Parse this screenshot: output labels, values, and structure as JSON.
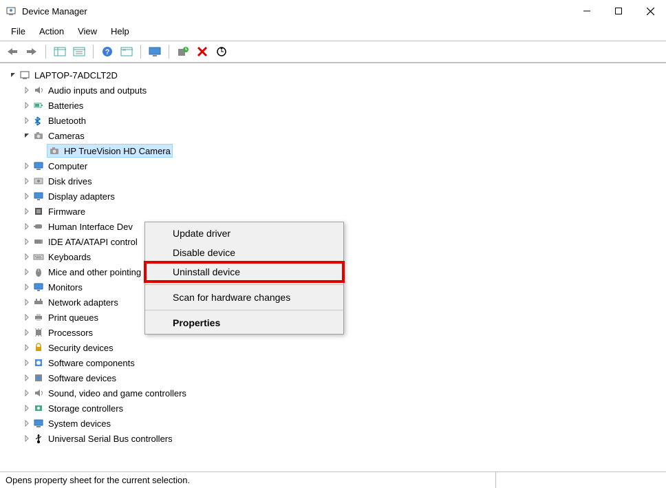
{
  "window": {
    "title": "Device Manager"
  },
  "menubar": [
    "File",
    "Action",
    "View",
    "Help"
  ],
  "toolbar_icons": [
    "back-icon",
    "forward-icon",
    "sep",
    "show-hide-console-tree-icon",
    "help-icon",
    "sep",
    "action-help-icon",
    "properties-page-icon",
    "sep",
    "monitor-icon",
    "sep",
    "update-driver-icon",
    "uninstall-icon",
    "scan-hardware-icon"
  ],
  "tree": {
    "root": {
      "label": "LAPTOP-7ADCLT2D",
      "expanded": true
    },
    "categories": [
      {
        "label": "Audio inputs and outputs",
        "icon": "speaker-icon",
        "expanded": false
      },
      {
        "label": "Batteries",
        "icon": "battery-icon",
        "expanded": false
      },
      {
        "label": "Bluetooth",
        "icon": "bluetooth-icon",
        "expanded": false
      },
      {
        "label": "Cameras",
        "icon": "camera-icon",
        "expanded": true,
        "children": [
          {
            "label": "HP TrueVision HD Camera",
            "icon": "camera-icon",
            "selected": true
          }
        ]
      },
      {
        "label": "Computer",
        "icon": "computer-icon",
        "expanded": false
      },
      {
        "label": "Disk drives",
        "icon": "disk-icon",
        "expanded": false
      },
      {
        "label": "Display adapters",
        "icon": "display-icon",
        "expanded": false
      },
      {
        "label": "Firmware",
        "icon": "firmware-icon",
        "expanded": false
      },
      {
        "label": "Human Interface Devices",
        "icon": "hid-icon",
        "expanded": false,
        "truncated": "Human Interface Dev"
      },
      {
        "label": "IDE ATA/ATAPI controllers",
        "icon": "ide-icon",
        "expanded": false,
        "truncated": "IDE ATA/ATAPI control"
      },
      {
        "label": "Keyboards",
        "icon": "keyboard-icon",
        "expanded": false
      },
      {
        "label": "Mice and other pointing devices",
        "icon": "mouse-icon",
        "expanded": false
      },
      {
        "label": "Monitors",
        "icon": "monitor-icon",
        "expanded": false
      },
      {
        "label": "Network adapters",
        "icon": "network-icon",
        "expanded": false
      },
      {
        "label": "Print queues",
        "icon": "printer-icon",
        "expanded": false
      },
      {
        "label": "Processors",
        "icon": "processor-icon",
        "expanded": false
      },
      {
        "label": "Security devices",
        "icon": "security-icon",
        "expanded": false
      },
      {
        "label": "Software components",
        "icon": "software-comp-icon",
        "expanded": false
      },
      {
        "label": "Software devices",
        "icon": "software-dev-icon",
        "expanded": false
      },
      {
        "label": "Sound, video and game controllers",
        "icon": "sound-icon",
        "expanded": false
      },
      {
        "label": "Storage controllers",
        "icon": "storage-icon",
        "expanded": false
      },
      {
        "label": "System devices",
        "icon": "system-icon",
        "expanded": false
      },
      {
        "label": "Universal Serial Bus controllers",
        "icon": "usb-icon",
        "expanded": false
      }
    ]
  },
  "context_menu": {
    "items": [
      {
        "label": "Update driver",
        "highlighted": false
      },
      {
        "label": "Disable device",
        "highlighted": false
      },
      {
        "label": "Uninstall device",
        "highlighted": true
      },
      {
        "sep": true
      },
      {
        "label": "Scan for hardware changes",
        "highlighted": false
      },
      {
        "sep": true
      },
      {
        "label": "Properties",
        "bold": true,
        "highlighted": false
      }
    ]
  },
  "statusbar": {
    "text": "Opens property sheet for the current selection."
  }
}
